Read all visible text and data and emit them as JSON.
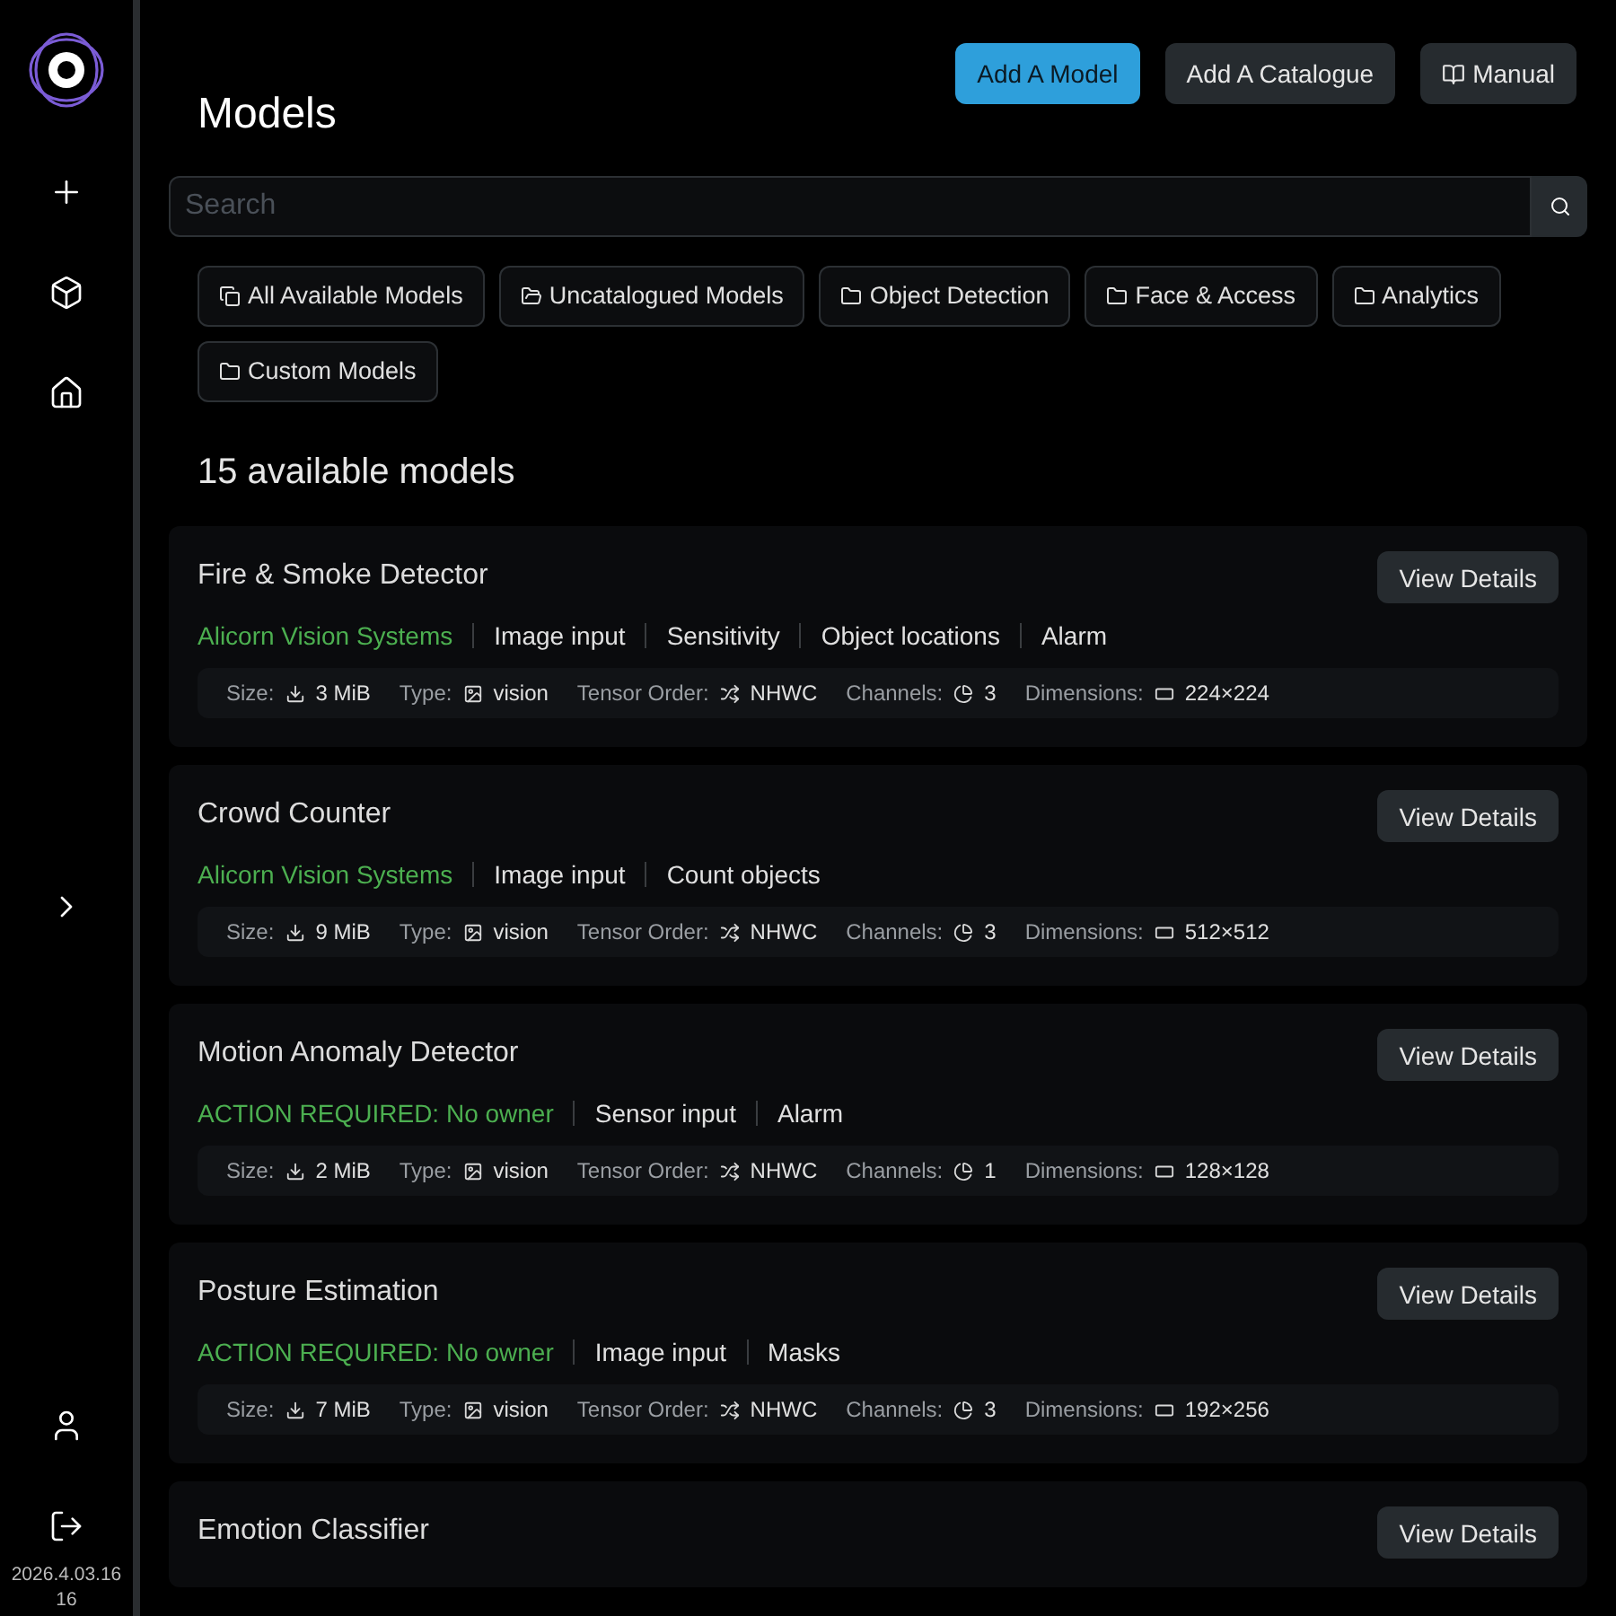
{
  "sidebar": {
    "items": [
      {
        "kind": "add"
      },
      {
        "kind": "cube"
      },
      {
        "kind": "home"
      },
      {
        "kind": "expand"
      },
      {
        "kind": "user"
      },
      {
        "kind": "logout"
      }
    ],
    "version": "2026.4.03.1616"
  },
  "header": {
    "title": "Models",
    "buttons": [
      {
        "label": "Add A Model",
        "kind": "primary"
      },
      {
        "label": "Add A Catalogue",
        "kind": "secondary"
      },
      {
        "label": "Manual",
        "kind": "manual"
      }
    ]
  },
  "search": {
    "placeholder": "Search"
  },
  "filters": [
    {
      "label": "All Available Models",
      "kind": "stack"
    },
    {
      "label": "Uncatalogued Models",
      "kind": "uncatalogued"
    },
    {
      "label": "Object Detection",
      "kind": "folder"
    },
    {
      "label": "Face & Access",
      "kind": "folder"
    },
    {
      "label": "Analytics",
      "kind": "folder"
    },
    {
      "label": "Custom Models",
      "kind": "folder"
    }
  ],
  "count": "15 available models",
  "models": [
    {
      "name": "Fire & Smoke Detector",
      "action": "View Details",
      "tags": [
        {
          "text": "Alicorn Vision Systems",
          "kind": "owner"
        },
        {
          "text": "Image input",
          "kind": "feature"
        },
        {
          "text": "Sensitivity",
          "kind": "feature"
        },
        {
          "text": "Object locations",
          "kind": "feature"
        },
        {
          "text": "Alarm",
          "kind": "feature"
        }
      ],
      "specs": [
        {
          "label": "Size:",
          "value": "3 MiB",
          "kind": "size"
        },
        {
          "label": "Type:",
          "value": "vision",
          "kind": "type"
        },
        {
          "label": "Tensor Order:",
          "value": "NHWC",
          "kind": "order"
        },
        {
          "label": "Channels:",
          "value": "3",
          "kind": "channels"
        },
        {
          "label": "Dimensions:",
          "value": "224×224",
          "kind": "dimensions"
        }
      ]
    },
    {
      "name": "Crowd Counter",
      "action": "View Details",
      "tags": [
        {
          "text": "Alicorn Vision Systems",
          "kind": "owner"
        },
        {
          "text": "Image input",
          "kind": "feature"
        },
        {
          "text": "Count objects",
          "kind": "feature"
        }
      ],
      "specs": [
        {
          "label": "Size:",
          "value": "9 MiB",
          "kind": "size"
        },
        {
          "label": "Type:",
          "value": "vision",
          "kind": "type"
        },
        {
          "label": "Tensor Order:",
          "value": "NHWC",
          "kind": "order"
        },
        {
          "label": "Channels:",
          "value": "3",
          "kind": "channels"
        },
        {
          "label": "Dimensions:",
          "value": "512×512",
          "kind": "dimensions"
        }
      ]
    },
    {
      "name": "Motion Anomaly Detector",
      "action": "View Details",
      "tags": [
        {
          "text": "ACTION REQUIRED: No owner",
          "kind": "owner"
        },
        {
          "text": "Sensor input",
          "kind": "feature"
        },
        {
          "text": "Alarm",
          "kind": "feature"
        }
      ],
      "specs": [
        {
          "label": "Size:",
          "value": "2 MiB",
          "kind": "size"
        },
        {
          "label": "Type:",
          "value": "vision",
          "kind": "type"
        },
        {
          "label": "Tensor Order:",
          "value": "NHWC",
          "kind": "order"
        },
        {
          "label": "Channels:",
          "value": "1",
          "kind": "channels"
        },
        {
          "label": "Dimensions:",
          "value": "128×128",
          "kind": "dimensions"
        }
      ]
    },
    {
      "name": "Posture Estimation",
      "action": "View Details",
      "tags": [
        {
          "text": "ACTION REQUIRED: No owner",
          "kind": "owner"
        },
        {
          "text": "Image input",
          "kind": "feature"
        },
        {
          "text": "Masks",
          "kind": "feature"
        }
      ],
      "specs": [
        {
          "label": "Size:",
          "value": "7 MiB",
          "kind": "size"
        },
        {
          "label": "Type:",
          "value": "vision",
          "kind": "type"
        },
        {
          "label": "Tensor Order:",
          "value": "NHWC",
          "kind": "order"
        },
        {
          "label": "Channels:",
          "value": "3",
          "kind": "channels"
        },
        {
          "label": "Dimensions:",
          "value": "192×256",
          "kind": "dimensions"
        }
      ]
    },
    {
      "name": "Emotion Classifier",
      "action": "View Details"
    }
  ]
}
